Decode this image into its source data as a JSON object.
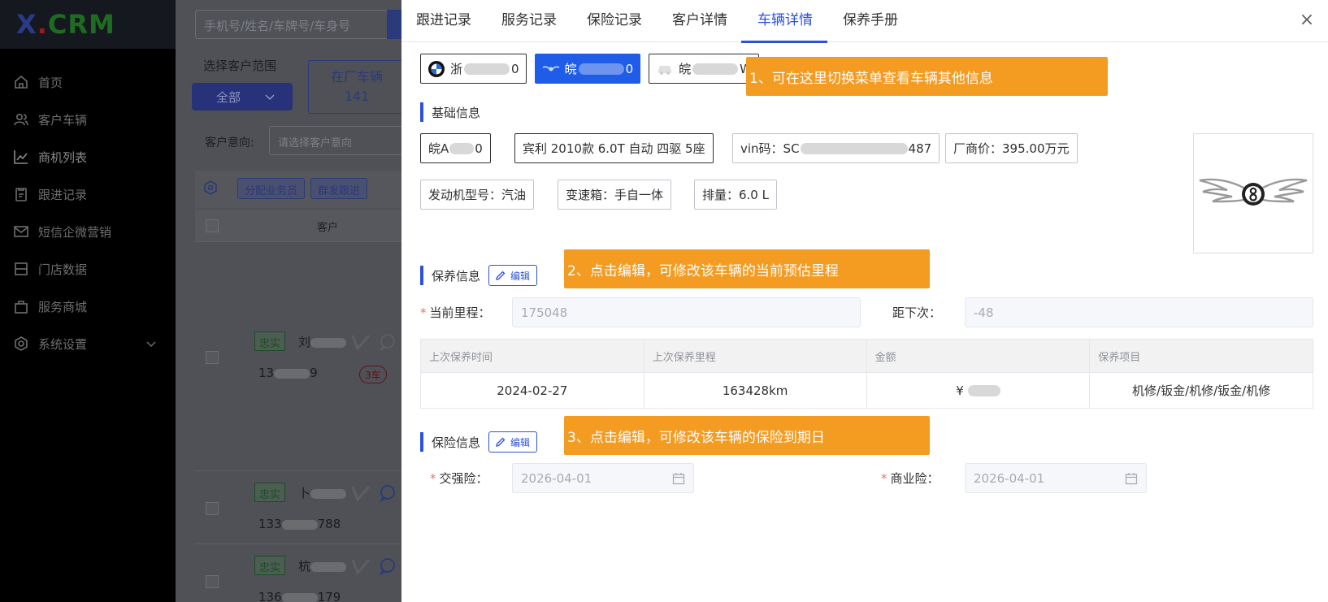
{
  "logo": {
    "x": "X",
    "dot": ".",
    "crm": "CRM"
  },
  "sidebar": {
    "items": [
      {
        "label": "首页",
        "icon": "home-icon"
      },
      {
        "label": "客户车辆",
        "icon": "users-icon"
      },
      {
        "label": "商机列表",
        "icon": "chart-line-icon"
      },
      {
        "label": "跟进记录",
        "icon": "clipboard-icon"
      },
      {
        "label": "短信企微营销",
        "icon": "mail-icon"
      },
      {
        "label": "门店数据",
        "icon": "data-icon"
      },
      {
        "label": "服务商城",
        "icon": "bag-icon"
      },
      {
        "label": "系统设置",
        "icon": "gear-icon"
      }
    ]
  },
  "background": {
    "search_placeholder": "手机号/姓名/车牌号/车身号",
    "scope_label": "选择客户范围",
    "scope_value": "全部",
    "instock_label": "在厂车辆",
    "instock_count": "141",
    "intent_label": "客户意向:",
    "intent_placeholder": "请选择客户意向",
    "assign_button": "分配业务员",
    "group_follow_button": "群发跟进",
    "customer_column": "客户",
    "rows": [
      {
        "badge": "忠实",
        "name": "刘",
        "phone_start": "13",
        "phone_end": "9",
        "cars": "3车"
      },
      {
        "badge": "忠实",
        "name": "卜",
        "phone_start": "133",
        "phone_end": "788"
      },
      {
        "badge": "忠实",
        "name": "杭",
        "phone_start": "136",
        "phone_end": "179"
      }
    ]
  },
  "drawer": {
    "tabs": [
      "跟进记录",
      "服务记录",
      "保险记录",
      "客户详情",
      "车辆详情",
      "保养手册"
    ],
    "active_tab": 4,
    "close": "×",
    "cars": [
      {
        "start": "浙",
        "end": "0",
        "logo": "bmw-logo-icon"
      },
      {
        "start": "皖",
        "end": "0",
        "logo": "bentley-logo-icon"
      },
      {
        "start": "皖",
        "end": "W",
        "logo": "car-icon"
      }
    ],
    "callouts": {
      "c1": "1、可在这里切换菜单查看车辆其他信息",
      "c2": "2、点击编辑，可修改该车辆的当前预估里程",
      "c3": "3、点击编辑，可修改该车辆的保险到期日"
    },
    "basic": {
      "title": "基础信息",
      "plate_start": "皖A",
      "plate_end": "0",
      "model": "宾利 2010款 6.0T 自动 四驱 5座",
      "vin_start": "vin码：SC",
      "vin_end": "487",
      "price": "厂商价：395.00万元",
      "engine": "发动机型号：汽油",
      "gearbox": "变速箱：手自一体",
      "displacement": "排量：6.0 L"
    },
    "maintenance": {
      "title": "保养信息",
      "edit": "编辑",
      "mileage_label": "当前里程：",
      "mileage_value": "175048",
      "next_label": "距下次：",
      "next_value": "-48",
      "table": {
        "headers": [
          "上次保养时间",
          "上次保养里程",
          "金额",
          "保养项目"
        ],
        "row": {
          "date": "2024-02-27",
          "mileage": "163428km",
          "amount_prefix": "¥",
          "items": "机修/钣金/机修/钣金/机修"
        }
      }
    },
    "insurance": {
      "title": "保险信息",
      "edit": "编辑",
      "compulsory_label": "交强险：",
      "compulsory_value": "2026-04-01",
      "commercial_label": "商业险：",
      "commercial_value": "2026-04-01"
    }
  },
  "colors": {
    "accent": "#2d52d9",
    "callout": "#f49b22",
    "selected_car": "#1f5ce8"
  }
}
